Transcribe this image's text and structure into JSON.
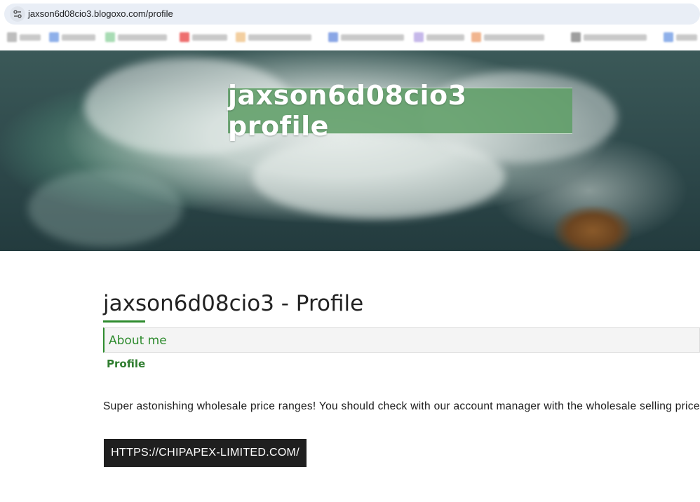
{
  "browser": {
    "url": "jaxson6d08cio3.blogoxo.com/profile",
    "site_info_icon": "tune-icon"
  },
  "hero": {
    "title": "jaxson6d08cio3 profile"
  },
  "profile": {
    "heading": "jaxson6d08cio3 - Profile",
    "about_tab": "About me",
    "section_label": "Profile",
    "description": "Super astonishing wholesale price ranges! You should check with our account manager with the wholesale selling price",
    "link_label": "HTTPS://CHIPAPEX-LIMITED.COM/"
  },
  "colors": {
    "accent_green": "#2e8b2e",
    "hero_title_bg": "#609e68",
    "button_bg": "#1f1f1f"
  }
}
